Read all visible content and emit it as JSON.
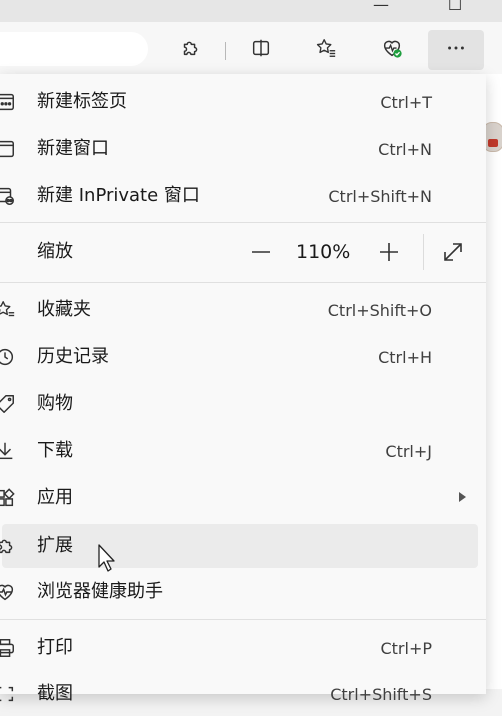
{
  "window": {
    "minimize_glyph": "—",
    "restore_glyph": "☐"
  },
  "toolbar": {
    "buttons": [
      "extensions-icon",
      "split-screen-icon",
      "favorites-icon",
      "browser-health-icon",
      "more-icon"
    ]
  },
  "menu": {
    "items": [
      {
        "label": "新建标签页",
        "shortcut": "Ctrl+T",
        "icon": "new-tab-icon"
      },
      {
        "label": "新建窗口",
        "shortcut": "Ctrl+N",
        "icon": "new-window-icon"
      },
      {
        "label": "新建 InPrivate 窗口",
        "shortcut": "Ctrl+Shift+N",
        "icon": "inprivate-icon"
      },
      {
        "label": "收藏夹",
        "shortcut": "Ctrl+Shift+O",
        "icon": "favorites-icon"
      },
      {
        "label": "历史记录",
        "shortcut": "Ctrl+H",
        "icon": "history-icon"
      },
      {
        "label": "购物",
        "shortcut": "",
        "icon": "shopping-tag-icon"
      },
      {
        "label": "下载",
        "shortcut": "Ctrl+J",
        "icon": "download-icon"
      },
      {
        "label": "应用",
        "shortcut": "",
        "icon": "apps-icon"
      },
      {
        "label": "扩展",
        "shortcut": "",
        "icon": "extensions-icon"
      },
      {
        "label": "浏览器健康助手",
        "shortcut": "",
        "icon": "browser-health-icon"
      },
      {
        "label": "打印",
        "shortcut": "Ctrl+P",
        "icon": "print-icon"
      },
      {
        "label": "截图",
        "shortcut": "Ctrl+Shift+S",
        "icon": "screenshot-icon"
      }
    ],
    "zoom": {
      "label": "缩放",
      "value": "110%",
      "minus": "—",
      "plus": "+"
    }
  },
  "colors": {
    "menu_bg": "#f9f9f9",
    "hover_bg": "#ebebeb",
    "health_badge": "#1e9e3e"
  }
}
